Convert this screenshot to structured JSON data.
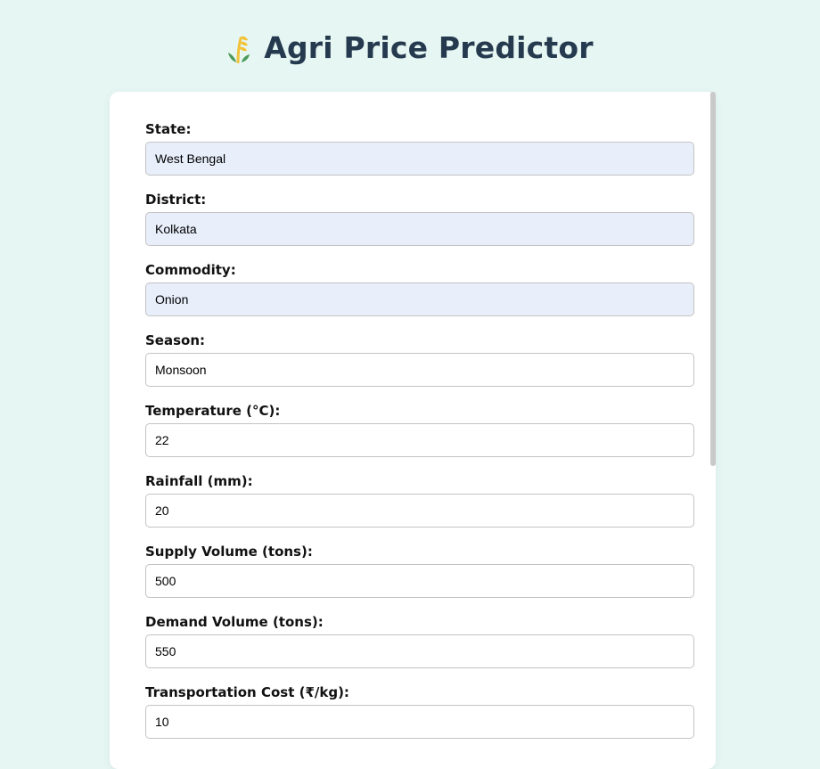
{
  "header": {
    "title": "Agri Price Predictor",
    "logo_icon": "wheat-icon"
  },
  "form": {
    "fields": [
      {
        "label": "State:",
        "value": "West Bengal"
      },
      {
        "label": "District:",
        "value": "Kolkata"
      },
      {
        "label": "Commodity:",
        "value": "Onion"
      },
      {
        "label": "Season:",
        "value": "Monsoon"
      },
      {
        "label": "Temperature (°C):",
        "value": "22"
      },
      {
        "label": "Rainfall (mm):",
        "value": "20"
      },
      {
        "label": "Supply Volume (tons):",
        "value": "500"
      },
      {
        "label": "Demand Volume (tons):",
        "value": "550"
      },
      {
        "label": "Transportation Cost (₹/kg):",
        "value": "10"
      }
    ]
  },
  "colors": {
    "page_background": "#e6f6f2",
    "title": "#253a4e",
    "autofill_background": "#e8effb",
    "input_border": "#c3c3c3"
  }
}
